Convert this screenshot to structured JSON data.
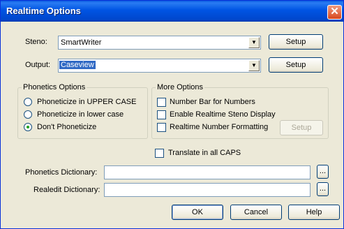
{
  "window": {
    "title": "Realtime Options",
    "close_glyph": "✕"
  },
  "steno": {
    "label": "Steno:",
    "value": "SmartWriter",
    "setup_label": "Setup"
  },
  "output": {
    "label": "Output:",
    "value": "Caseview",
    "setup_label": "Setup"
  },
  "phonetics": {
    "title": "Phonetics Options",
    "options": [
      {
        "label": "Phoneticize in UPPER CASE",
        "selected": false
      },
      {
        "label": "Phoneticize in lower case",
        "selected": false
      },
      {
        "label": "Don't Phoneticize",
        "selected": true
      }
    ]
  },
  "more_options": {
    "title": "More Options",
    "items": [
      {
        "label": "Number Bar for Numbers",
        "checked": false
      },
      {
        "label": "Enable Realtime Steno Display",
        "checked": false
      },
      {
        "label": "Realtime Number Formatting",
        "checked": false
      }
    ],
    "setup_label": "Setup"
  },
  "translate_caps": {
    "label": "Translate in all CAPS",
    "checked": false
  },
  "phonetics_dictionary": {
    "label": "Phonetics Dictionary:",
    "value": "",
    "browse_label": "..."
  },
  "realedit_dictionary": {
    "label": "Realedit Dictionary:",
    "value": "",
    "browse_label": "..."
  },
  "buttons": {
    "ok": "OK",
    "cancel": "Cancel",
    "help": "Help"
  },
  "dropdown_arrow_glyph": "▼",
  "colors": {
    "titlebar": "#0054e3",
    "selection": "#316ac5",
    "face": "#ece9d8"
  }
}
